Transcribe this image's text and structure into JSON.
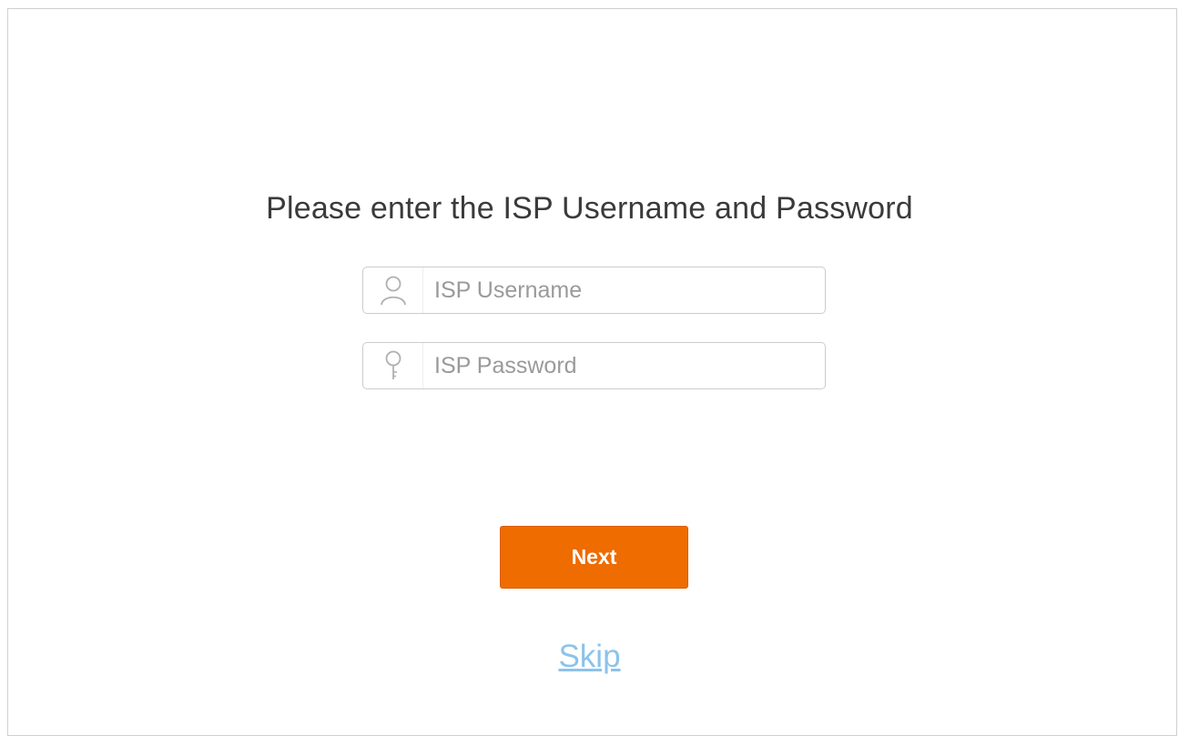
{
  "form": {
    "title": "Please enter the ISP Username and Password",
    "username": {
      "icon": "user-icon",
      "value": "",
      "placeholder": "ISP Username"
    },
    "password": {
      "icon": "key-icon",
      "value": "",
      "placeholder": "ISP Password"
    }
  },
  "actions": {
    "next_label": "Next",
    "skip_label": "Skip"
  },
  "colors": {
    "accent": "#ee6c00",
    "link": "#8cc3ea",
    "text": "#3a3a3a",
    "placeholder": "#9a9a9a"
  }
}
